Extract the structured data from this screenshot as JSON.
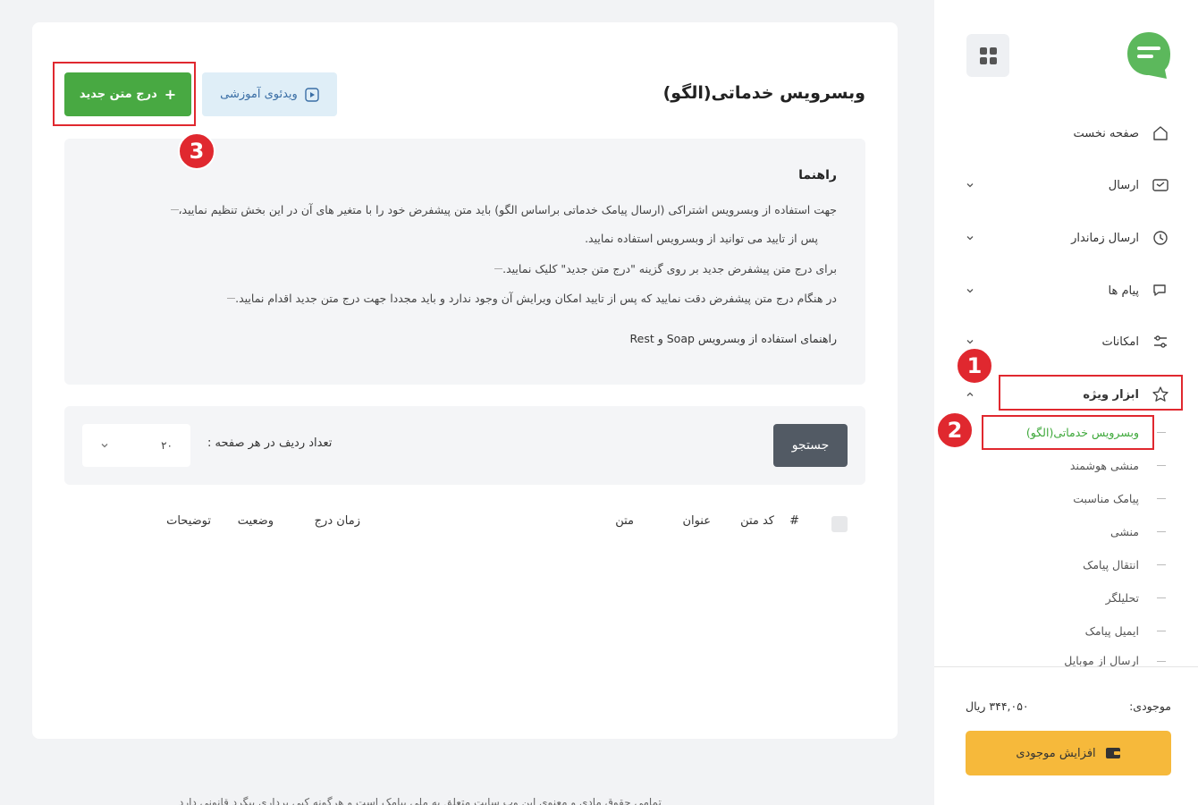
{
  "sidebar": {
    "nav": [
      {
        "label": "صفحه نخست",
        "icon": "home-icon"
      },
      {
        "label": "ارسال",
        "icon": "send-icon"
      },
      {
        "label": "ارسال زماندار",
        "icon": "clock-icon"
      },
      {
        "label": "پیام ها",
        "icon": "chat-icon"
      },
      {
        "label": "امکانات",
        "icon": "sliders-icon"
      },
      {
        "label": "ابزار ویژه",
        "icon": "star-icon"
      }
    ],
    "submenu": [
      "وبسرویس خدماتی(الگو)",
      "منشی هوشمند",
      "پیامک مناسبت",
      "منشی",
      "انتقال پیامک",
      "تحلیلگر",
      "ایمیل پیامک",
      "ارسال از موبایل"
    ],
    "balance_label": "موجودی:",
    "balance_value": "۳۴۴,۰۵۰ ریال",
    "topup_label": "افزایش موجودی"
  },
  "main": {
    "title": "وبسرویس خدماتی(الگو)",
    "video_button": "ویدئوی آموزشی",
    "insert_button": "درج متن جدید",
    "guide": {
      "title": "راهنما",
      "lines": [
        "جهت استفاده از وبسرویس اشتراکی (ارسال پیامک خدماتی براساس الگو) باید متن پیشفرض خود را با متغیر های آن در این بخش تنظیم نمایید،",
        "پس از تایید می توانید از وبسرویس استفاده نمایید.",
        "برای درج متن پیشفرض جدید بر روی گزینه \"درج متن جدید\" کلیک نمایید.",
        "در هنگام درج متن پیشفرض دقت نمایید که پس از تایید امکان ویرایش آن وجود ندارد و باید مجددا جهت درج متن جدید اقدام نمایید."
      ],
      "link": "راهنمای استفاده از وبسرویس Soap و Rest"
    },
    "filter": {
      "search_button": "جستجو",
      "rows_label": "تعداد ردیف در هر صفحه :",
      "rows_value": "۲۰"
    },
    "table_headers": [
      "#",
      "کد متن",
      "عنوان",
      "متن",
      "زمان درج",
      "وضعیت",
      "توضیحات"
    ]
  },
  "footer": {
    "text": "تمامی حقوق مادی و معنوی این وب سایت متعلق به ملی پیامک است و هرگونه کپی برداری پیگرد قانونی دارد"
  },
  "annotations": [
    "1",
    "2",
    "3"
  ],
  "colors": {
    "accent_green": "#48a942",
    "annotation_red": "#e0282f",
    "topup_yellow": "#f6b93b"
  }
}
